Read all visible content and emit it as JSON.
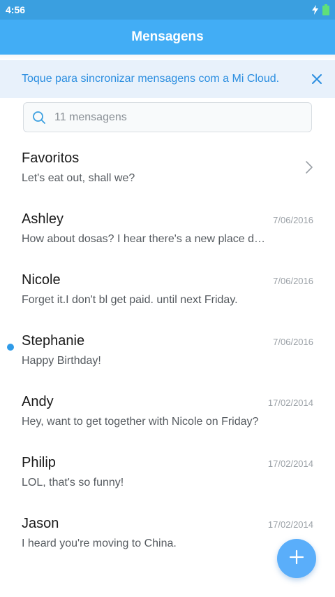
{
  "status_bar": {
    "time": "4:56"
  },
  "app_bar": {
    "title": "Mensagens"
  },
  "sync_banner": {
    "text": "Toque para sincronizar mensagens com a Mi Cloud."
  },
  "search": {
    "placeholder": "11 mensagens"
  },
  "conversations": [
    {
      "name": "Favoritos",
      "date": "",
      "preview": "Let's eat out, shall we?"
    },
    {
      "name": "Ashley",
      "date": "7/06/2016",
      "preview": "How about dosas? I hear there's a new place do…"
    },
    {
      "name": "Nicole",
      "date": "7/06/2016",
      "preview": "Forget it.I don't bl get paid. until next Friday."
    },
    {
      "name": "Stephanie",
      "date": "7/06/2016",
      "preview": "Happy Birthday!"
    },
    {
      "name": "Andy",
      "date": "17/02/2014",
      "preview": "Hey, want to get together with Nicole on Friday?"
    },
    {
      "name": "Philip",
      "date": "17/02/2014",
      "preview": "LOL, that's so funny!"
    },
    {
      "name": "Jason",
      "date": "17/02/2014",
      "preview": "I heard you're moving to China."
    }
  ],
  "colors": {
    "status_bar": "#3a9fe0",
    "app_bar": "#42adf5",
    "accent": "#2b8ee0",
    "fab": "#5aaefa",
    "unread_dot": "#2f9be8"
  },
  "icons": {
    "status": [
      "bolt-icon",
      "battery-icon"
    ],
    "banner_close": "close-icon",
    "search": "search-icon",
    "favorites_chevron": "chevron-right-icon",
    "fab": "plus-icon"
  }
}
